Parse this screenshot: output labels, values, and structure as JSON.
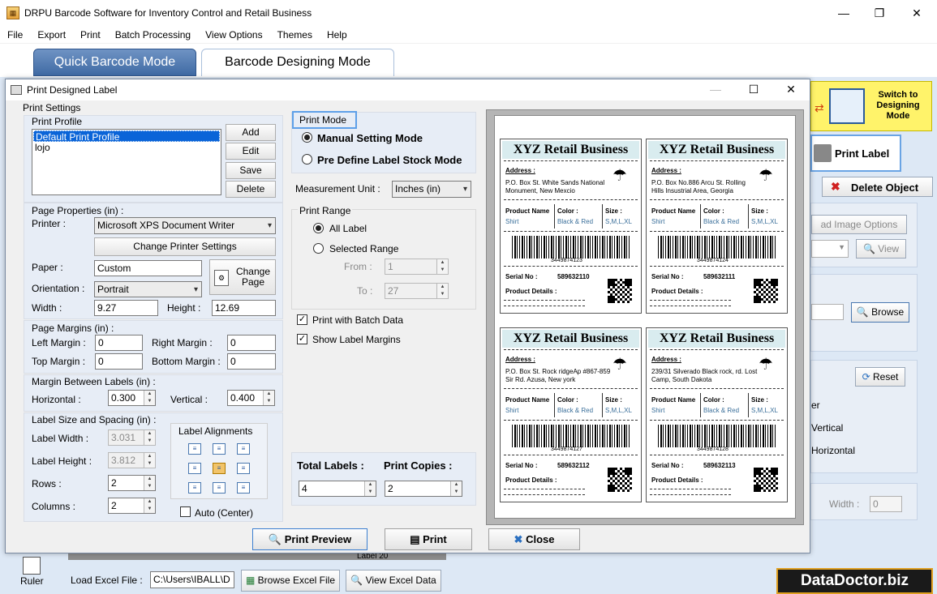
{
  "window": {
    "title": "DRPU Barcode Software for Inventory Control and Retail Business",
    "minimize": "—",
    "maximize": "❐",
    "close": "✕"
  },
  "menu": [
    "File",
    "Export",
    "Print",
    "Batch Processing",
    "View Options",
    "Themes",
    "Help"
  ],
  "modes": {
    "quick": "Quick Barcode Mode",
    "design": "Barcode Designing Mode"
  },
  "background": {
    "switch_label": "Switch to Designing Mode",
    "print_label": "Print Label",
    "delete_object": "Delete Object",
    "image_options": "ad Image Options",
    "view": "View",
    "browse": "Browse",
    "reset": "Reset",
    "er": "er",
    "vertical": "Vertical",
    "horizontal": "Horizontal",
    "width_label": "Width :",
    "width_value": "0",
    "ruler": "Ruler",
    "load_excel": "Load Excel File :",
    "excel_path": "C:\\Users\\IBALL\\D",
    "browse_excel": "Browse Excel File",
    "view_excel": "View Excel Data",
    "label_tab": "Label 20",
    "brand": "DataDoctor.biz"
  },
  "dialog": {
    "title": "Print Designed Label",
    "print_settings": "Print Settings",
    "print_profile": "Print Profile",
    "profiles": [
      "Default Print Profile",
      "lojo"
    ],
    "profile_buttons": {
      "add": "Add",
      "edit": "Edit",
      "save": "Save",
      "delete": "Delete"
    },
    "page_properties": "Page Properties (in) :",
    "printer_label": "Printer :",
    "printer_value": "Microsoft XPS Document Writer",
    "change_printer": "Change Printer Settings",
    "paper_label": "Paper :",
    "paper_value": "Custom",
    "change_page": "Change Page",
    "orientation_label": "Orientation :",
    "orientation_value": "Portrait",
    "width_label": "Width :",
    "width_value": "9.27",
    "height_label": "Height :",
    "height_value": "12.69",
    "page_margins": "Page Margins (in) :",
    "left_margin_label": "Left Margin :",
    "left_margin": "0",
    "right_margin_label": "Right Margin :",
    "right_margin": "0",
    "top_margin_label": "Top Margin :",
    "top_margin": "0",
    "bottom_margin_label": "Bottom Margin :",
    "bottom_margin": "0",
    "margin_between": "Margin Between Labels (in) :",
    "horizontal_label": "Horizontal :",
    "horizontal_value": "0.300",
    "vertical_label": "Vertical :",
    "vertical_value": "0.400",
    "label_size": "Label Size and Spacing (in) :",
    "label_width_label": "Label Width :",
    "label_width": "3.031",
    "label_height_label": "Label Height :",
    "label_height": "3.812",
    "rows_label": "Rows :",
    "rows": "2",
    "columns_label": "Columns :",
    "columns": "2",
    "label_alignments": "Label Alignments",
    "auto_center": "Auto (Center)",
    "print_mode": "Print Mode",
    "manual_mode": "Manual Setting Mode",
    "predefine_mode": "Pre Define Label Stock Mode",
    "measurement_label": "Measurement Unit :",
    "measurement_value": "Inches (in)",
    "print_range": "Print Range",
    "all_label": "All Label",
    "selected_range": "Selected Range",
    "from_label": "From :",
    "from_value": "1",
    "to_label": "To :",
    "to_value": "27",
    "print_batch": "Print with Batch Data",
    "show_margins": "Show Label Margins",
    "total_labels_label": "Total Labels :",
    "total_labels": "4",
    "print_copies_label": "Print Copies :",
    "print_copies": "2",
    "print_preview": "Print Preview",
    "print": "Print",
    "close": "Close"
  },
  "preview_labels": [
    {
      "business": "XYZ Retail Business",
      "address_title": "Address :",
      "address1": "P.O. Box St. White Sands National",
      "address2": "Monument, New Mexcio",
      "product_name_title": "Product Name",
      "product_name": "Shirt",
      "color_title": "Color :",
      "color": "Black & Red",
      "size_title": "Size :",
      "size": "S,M,L,XL",
      "barcode_num": "3449874123",
      "serial_title": "Serial No :",
      "serial": "589632110",
      "details_title": "Product Details :"
    },
    {
      "business": "XYZ Retail Business",
      "address_title": "Address :",
      "address1": "P.O. Box No.886 Arcu St. Rolling",
      "address2": "Hills Insustrial Area, Georgia",
      "product_name_title": "Product Name",
      "product_name": "Shirt",
      "color_title": "Color :",
      "color": "Black & Red",
      "size_title": "Size :",
      "size": "S,M,L,XL",
      "barcode_num": "3449874124",
      "serial_title": "Serial No :",
      "serial": "589632111",
      "details_title": "Product Details :"
    },
    {
      "business": "XYZ Retail Business",
      "address_title": "Address :",
      "address1": "P.O. Box St. Rock ridgeAp #867-859",
      "address2": "Sir Rd. Azusa, New york",
      "product_name_title": "Product Name",
      "product_name": "Shirt",
      "color_title": "Color :",
      "color": "Black & Red",
      "size_title": "Size :",
      "size": "S,M,L,XL",
      "barcode_num": "3449874127",
      "serial_title": "Serial No :",
      "serial": "589632112",
      "details_title": "Product Details :"
    },
    {
      "business": "XYZ Retail Business",
      "address_title": "Address :",
      "address1": "239/31 Silverado Black rock, rd. Lost",
      "address2": "Camp, South Dakota",
      "product_name_title": "Product Name",
      "product_name": "Shirt",
      "color_title": "Color :",
      "color": "Black & Red",
      "size_title": "Size :",
      "size": "S,M,L,XL",
      "barcode_num": "3449874128",
      "serial_title": "Serial No :",
      "serial": "589632113",
      "details_title": "Product Details :"
    }
  ]
}
